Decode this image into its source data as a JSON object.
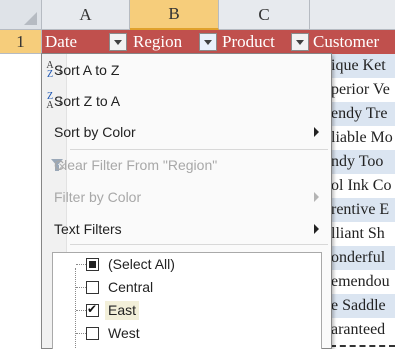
{
  "columns": [
    "A",
    "B",
    "C"
  ],
  "row_number": "1",
  "table_header": {
    "date": "Date",
    "region": "Region",
    "product": "Product",
    "customer": "Customer"
  },
  "customer_cells": [
    "ique Ket",
    "perior Ve",
    "endy Tre",
    "liable Mo",
    "ndy Too",
    "ol Ink Co",
    "rentive E",
    "lliant Sh",
    "onderful",
    "emendou",
    "e Saddle",
    "aranteed"
  ],
  "menu": {
    "sort_az": "Sort A to Z",
    "sort_za": "Sort Z to A",
    "sort_by_color": "Sort by Color",
    "clear_filter": "Clear Filter From \"Region\"",
    "filter_by_color": "Filter by Color",
    "text_filters": "Text Filters"
  },
  "icons": {
    "sort_az": "sort-ascending-icon",
    "sort_za": "sort-descending-icon",
    "clear_filter": "clear-filter-icon"
  },
  "values": [
    {
      "label": "(Select All)",
      "state": "mixed"
    },
    {
      "label": "Central",
      "state": "unchecked"
    },
    {
      "label": "East",
      "state": "checked"
    },
    {
      "label": "West",
      "state": "unchecked"
    }
  ],
  "colors": {
    "table_header": "#c0504d",
    "selected_header": "#f6cd7b",
    "band_row": "#dbe5f1"
  }
}
